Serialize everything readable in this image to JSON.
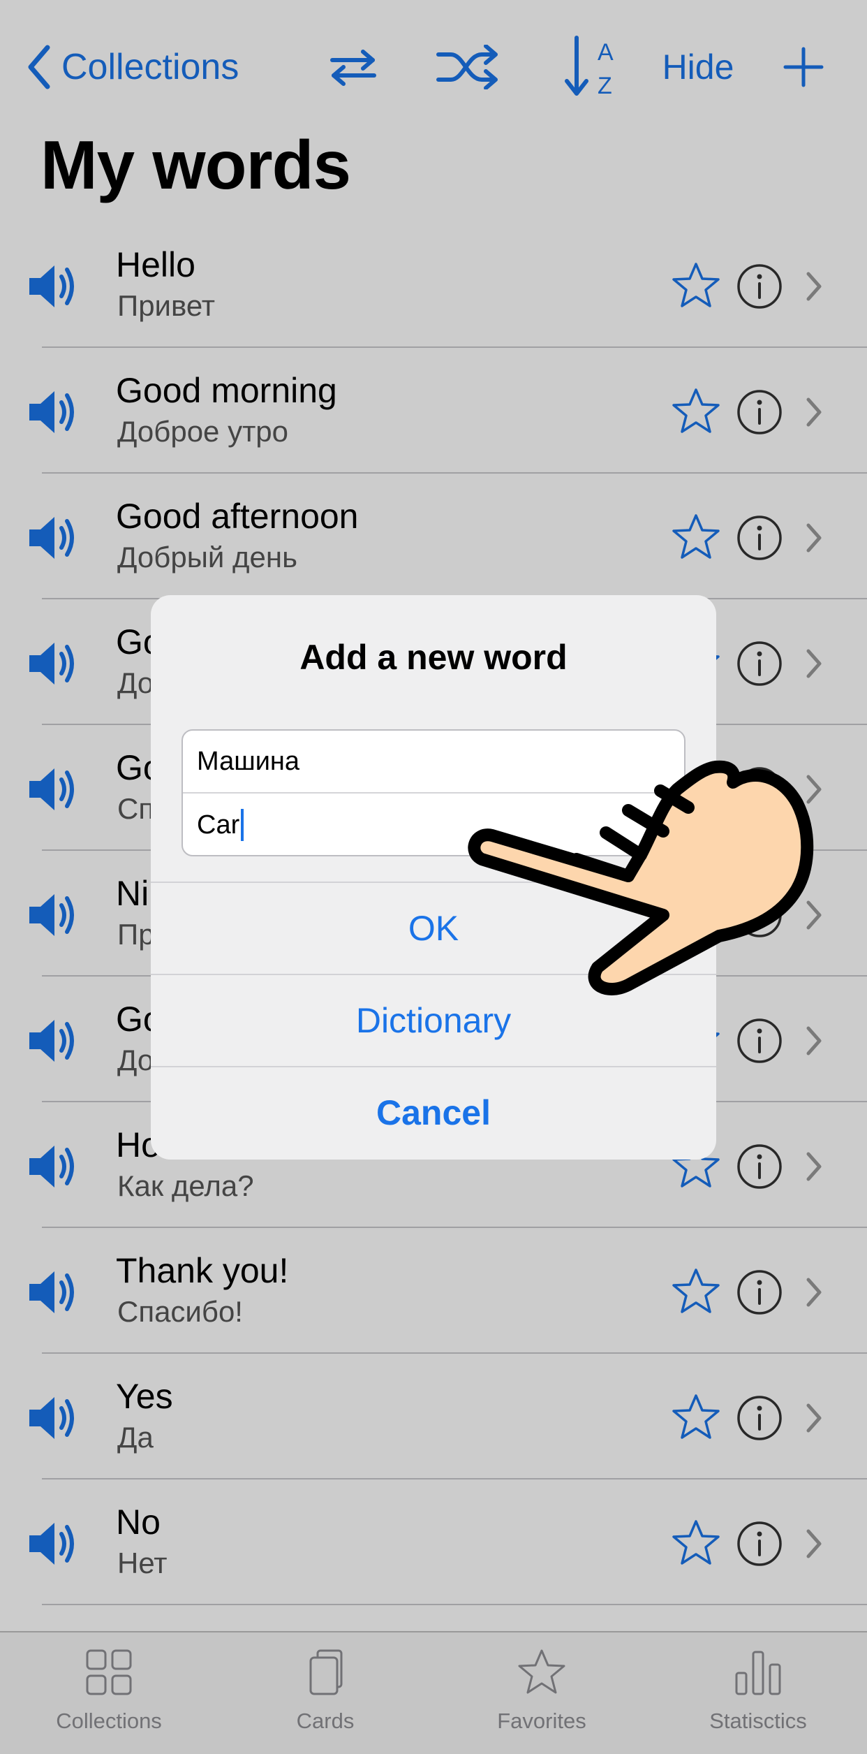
{
  "navbar": {
    "back_label": "Collections",
    "hide_label": "Hide",
    "icons": [
      "swap-icon",
      "shuffle-icon",
      "sort-az-icon",
      "plus-icon"
    ],
    "accent_color": "#1a73e8"
  },
  "page_title": "My words",
  "words": [
    {
      "word": "Hello",
      "translation": "Привет"
    },
    {
      "word": "Good morning",
      "translation": "Доброе утро"
    },
    {
      "word": "Good afternoon",
      "translation": "Добрый день"
    },
    {
      "word": "Go",
      "translation": "До"
    },
    {
      "word": "Go",
      "translation": "Сп"
    },
    {
      "word": "Ni",
      "translation": "Пр"
    },
    {
      "word": "Go",
      "translation": "До"
    },
    {
      "word": "Ho",
      "translation": "Как дела?"
    },
    {
      "word": "Thank you!",
      "translation": "Спасибо!"
    },
    {
      "word": "Yes",
      "translation": "Да"
    },
    {
      "word": "No",
      "translation": "Нет"
    }
  ],
  "tabs": [
    {
      "label": "Collections",
      "icon": "grid-icon"
    },
    {
      "label": "Cards",
      "icon": "cards-icon"
    },
    {
      "label": "Favorites",
      "icon": "star-icon"
    },
    {
      "label": "Statisctics",
      "icon": "bar-chart-icon"
    }
  ],
  "dialog": {
    "title": "Add a new word",
    "field_1_value": "Машина",
    "field_2_value": "Car",
    "ok_label": "OK",
    "dictionary_label": "Dictionary",
    "cancel_label": "Cancel"
  }
}
